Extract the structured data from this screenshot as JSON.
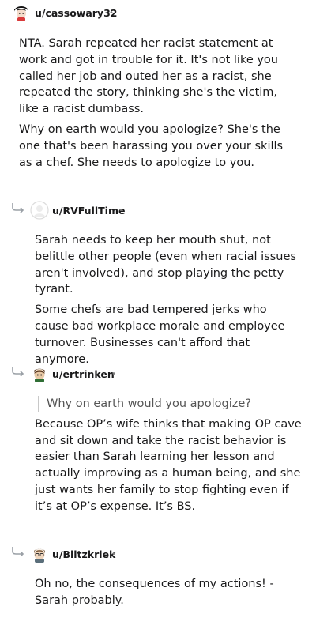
{
  "comments": [
    {
      "username": "u/cassowary32",
      "separator": "•",
      "avatar": "anime-girl-avatar",
      "paragraphs": [
        "NTA. Sarah repeated her racist statement at work and got in trouble for it. It's not like you called her job and outed her as a racist, she repeated the story, thinking she's the victim, like a racist dumbass.",
        "Why on earth would you apologize? She's the one that's been harassing you over your skills as a chef. She needs to apologize to you."
      ]
    },
    {
      "username": "u/RVFullTime",
      "separator": "•",
      "avatar": "placeholder-avatar",
      "paragraphs": [
        "Sarah needs to keep her mouth shut, not belittle other people (even when racial issues aren't involved), and stop playing the petty tyrant.",
        "Some chefs are bad tempered jerks who cause bad workplace morale and employee turnover. Businesses can't afford that anymore."
      ]
    },
    {
      "username": "u/ertrinken",
      "separator": "•",
      "avatar": "character-avatar",
      "quote": "Why on earth would you apologize?",
      "paragraphs": [
        "Because OP’s wife thinks that making OP cave and sit down and take the racist behavior is easier than Sarah learning her lesson and actually improving as a human being, and she just wants her family to stop fighting even if it’s at OP’s expense. It’s BS."
      ]
    },
    {
      "username": "u/Blitzkriek",
      "separator": "•",
      "avatar": "character-avatar",
      "paragraphs": [
        "Oh no, the consequences of my actions! - Sarah probably."
      ]
    }
  ]
}
